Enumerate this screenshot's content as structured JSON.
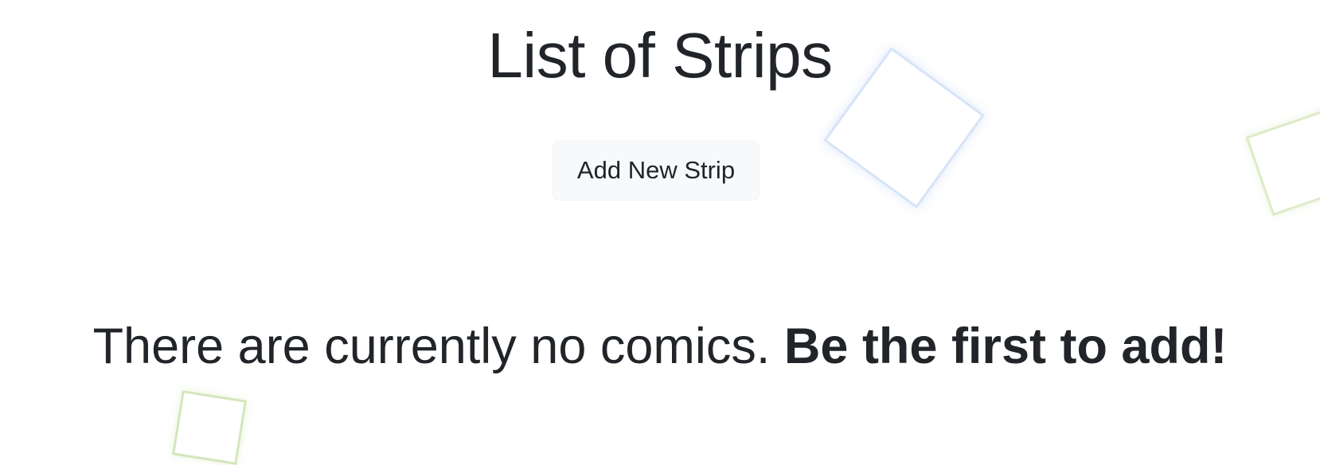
{
  "header": {
    "title": "List of Strips"
  },
  "actions": {
    "add_label": "Add New Strip"
  },
  "empty_state": {
    "message": "There are currently no comics.",
    "cta": "Be the first to add!"
  },
  "colors": {
    "text": "#212529",
    "button_bg": "#f8f9fa",
    "deco_blue": "#d6e4f7",
    "deco_green": "#dcebc6"
  }
}
